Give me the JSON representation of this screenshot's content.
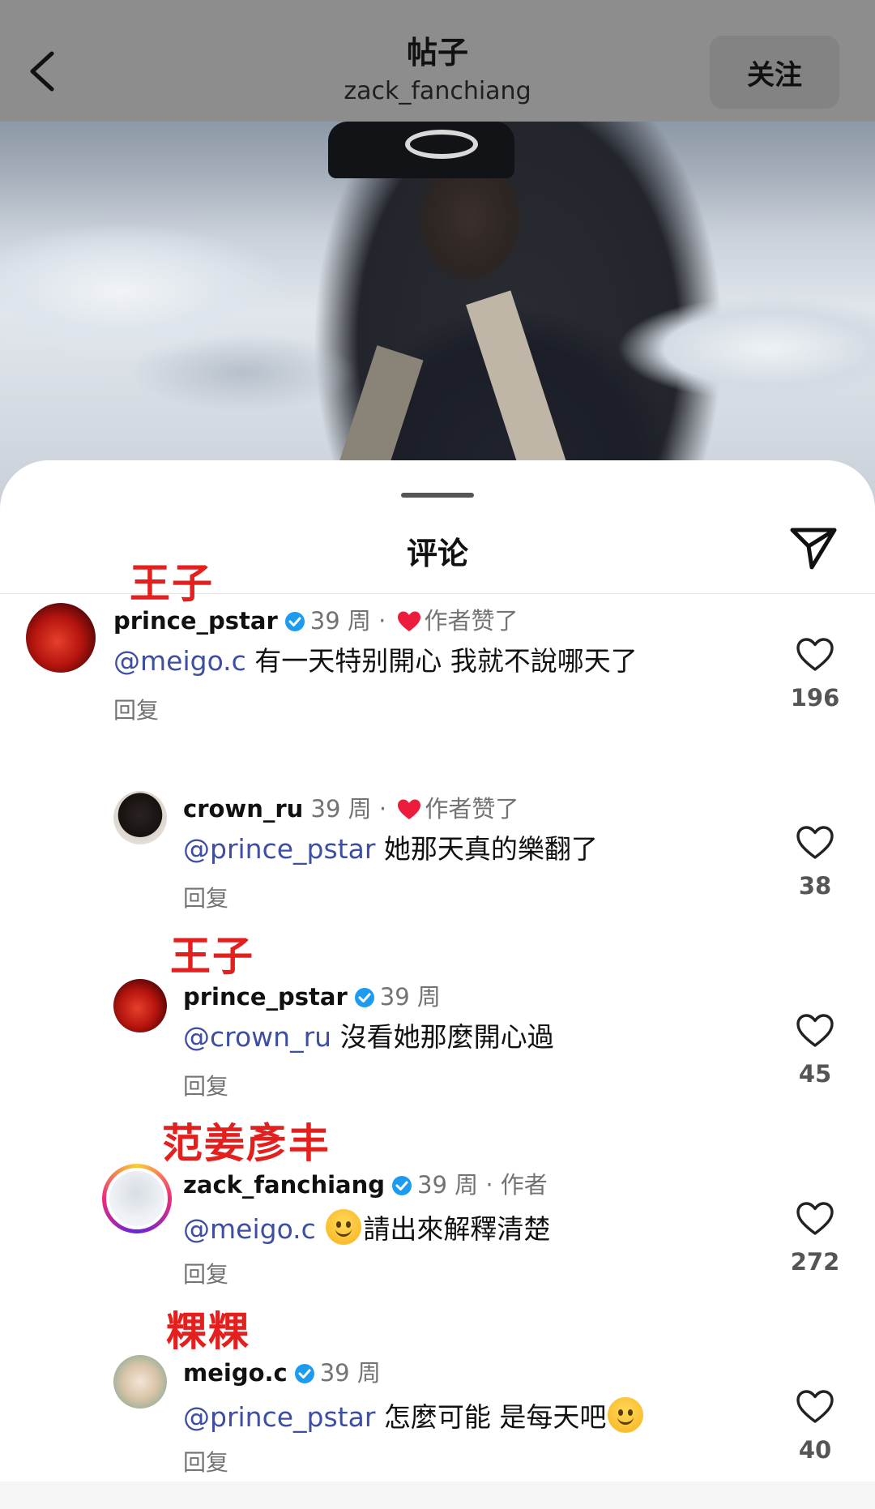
{
  "header": {
    "title": "帖子",
    "username": "zack_fanchiang",
    "follow_label": "关注"
  },
  "sheet": {
    "title": "评论"
  },
  "annotations": {
    "a1": "王子",
    "a2": "王子",
    "a3": "范姜彥丰",
    "a4": "粿粿"
  },
  "comments": [
    {
      "username": "prince_pstar",
      "time": "39 周",
      "liked_by_author": "作者赞了",
      "mention": "@meigo.c",
      "text": " 有一天特别開心 我就不說哪天了",
      "reply": "回复",
      "likes": "196"
    },
    {
      "username": "crown_ru",
      "time": "39 周",
      "liked_by_author": "作者赞了",
      "mention": "@prince_pstar",
      "text": " 她那天真的樂翻了",
      "reply": "回复",
      "likes": "38"
    },
    {
      "username": "prince_pstar",
      "time": "39 周",
      "mention": "@crown_ru",
      "text": " 沒看她那麼開心過",
      "reply": "回复",
      "likes": "45"
    },
    {
      "username": "zack_fanchiang",
      "time": "39 周",
      "author_tag": "作者",
      "mention": "@meigo.c",
      "text": "請出來解釋清楚",
      "reply": "回复",
      "likes": "272"
    },
    {
      "username": "meigo.c",
      "time": "39 周",
      "mention": "@prince_pstar",
      "text": " 怎麼可能 是每天吧",
      "reply": "回复",
      "likes": "40"
    }
  ],
  "colors": {
    "annotation": "#e4201f",
    "mention": "#3d4ea3",
    "verified": "#1d9bf0",
    "heart": "#ed1b3c"
  },
  "icons": [
    "back-chevron-icon",
    "send-icon",
    "verified-icon",
    "heart-icon",
    "like-heart-icon",
    "smile-emoji-icon"
  ]
}
